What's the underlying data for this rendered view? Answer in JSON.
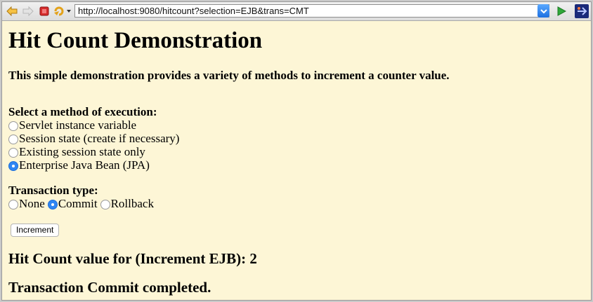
{
  "browser": {
    "url": "http://localhost:9080/hitcount?selection=EJB&trans=CMT"
  },
  "page": {
    "title": "Hit Count Demonstration",
    "intro": "This simple demonstration provides a variety of methods to increment a counter value.",
    "method_label": "Select a method of execution:",
    "methods": [
      {
        "label": "Servlet instance variable",
        "checked": false
      },
      {
        "label": "Session state (create if necessary)",
        "checked": false
      },
      {
        "label": "Existing session state only",
        "checked": false
      },
      {
        "label": "Enterprise Java Bean (JPA)",
        "checked": true
      }
    ],
    "transaction_label": "Transaction type:",
    "transactions": [
      {
        "label": "None",
        "checked": false
      },
      {
        "label": "Commit",
        "checked": true
      },
      {
        "label": "Rollback",
        "checked": false
      }
    ],
    "increment_button": "Increment",
    "result_hit": "Hit Count value for (Increment EJB): 2",
    "result_tx": "Transaction Commit completed."
  }
}
